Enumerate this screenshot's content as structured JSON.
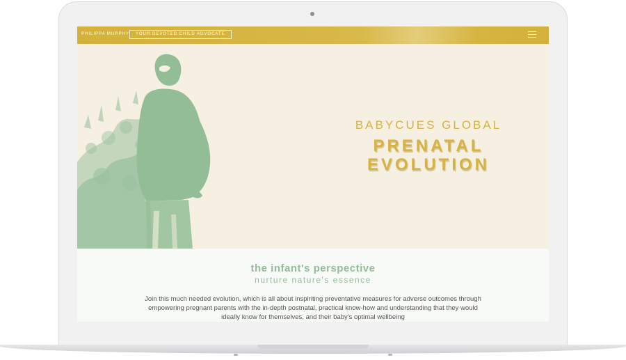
{
  "nav": {
    "brand": "PHILIPPA MURPHY",
    "tagline": "YOUR DEVOTED CHILD ADVOCATE",
    "menu_icon": "hamburger-menu-icon"
  },
  "hero": {
    "kicker": "BABYCUES GLOBAL",
    "title_line1": "PRENATAL",
    "title_line2": "EVOLUTION"
  },
  "content": {
    "heading": "the infant's perspective",
    "subheading": "nurture nature's essence",
    "body": "Join this much needed evolution, which is all about inspiriting preventative measures for adverse outcomes through empowering pregnant parents with the in-depth postnatal, practical know-how and understanding that they would ideally know for themselves, and their baby's optimal wellbeing"
  },
  "colors": {
    "gold": "#d8b241",
    "sage": "#93bd97",
    "cream": "#f5f0e1"
  }
}
